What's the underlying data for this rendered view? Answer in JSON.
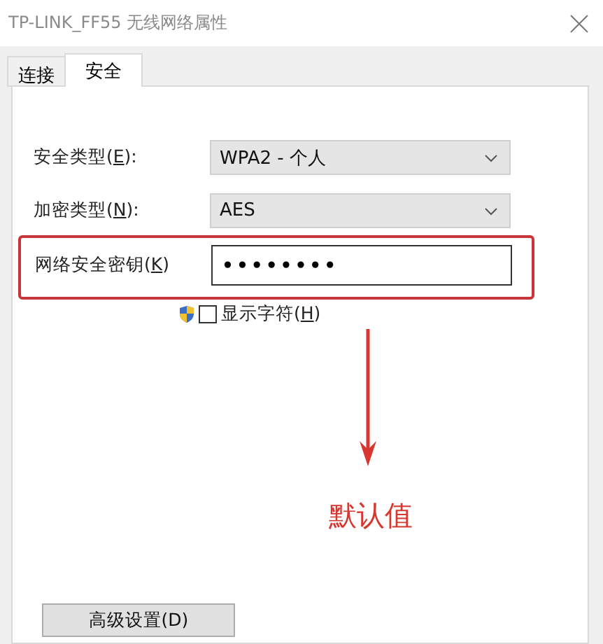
{
  "window": {
    "title": "TP-LINK_FF55 无线网络属性"
  },
  "tabs": [
    {
      "label": "连接",
      "selected": false
    },
    {
      "label": "安全",
      "selected": true
    }
  ],
  "fields": [
    {
      "kind": "dropdown",
      "label_before": "安全类型(",
      "access_key": "E",
      "label_after": "):",
      "value": "WPA2 - 个人",
      "highlighted": false
    },
    {
      "kind": "dropdown",
      "label_before": "加密类型(",
      "access_key": "N",
      "label_after": "):",
      "value": "AES",
      "highlighted": false
    },
    {
      "kind": "password",
      "label_before": "网络安全密钥(",
      "access_key": "K",
      "label_after": ")",
      "value": "••••••••",
      "highlighted": true
    }
  ],
  "show_characters": {
    "label_before": "显示字符(",
    "access_key": "H",
    "label_after": ")",
    "checked": false
  },
  "annotation": {
    "text": "默认值"
  },
  "advanced_button": {
    "label": "高级设置(D)"
  }
}
